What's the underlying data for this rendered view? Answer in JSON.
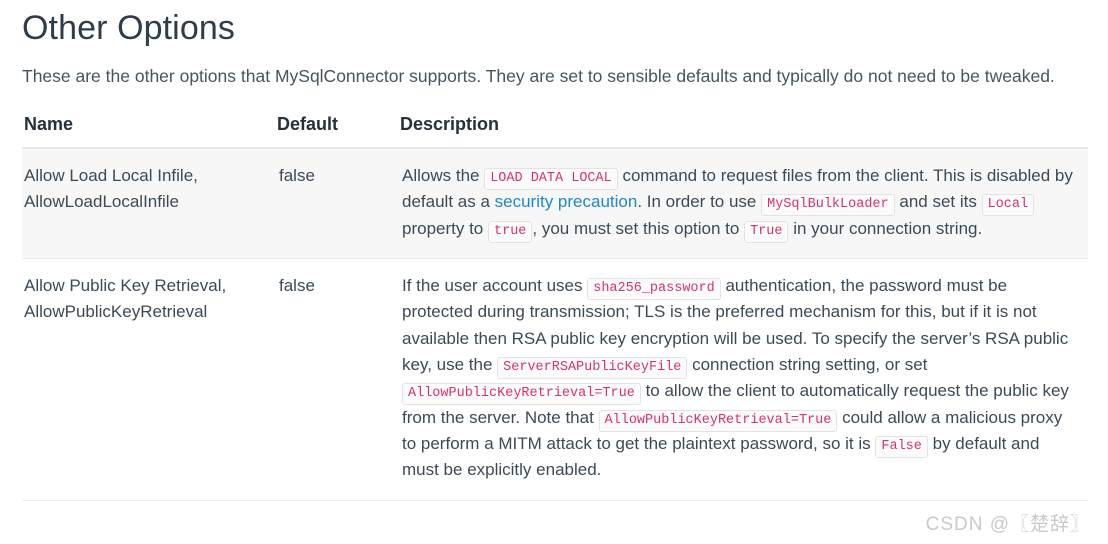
{
  "page": {
    "title": "Other Options",
    "intro": "These are the other options that MySqlConnector supports. They are set to sensible defaults and typically do not need to be tweaked.",
    "watermark": "CSDN @〖楚辞〗"
  },
  "table": {
    "headers": {
      "name": "Name",
      "default": "Default",
      "description": "Description"
    },
    "rows": [
      {
        "name": "Allow Load Local Infile, AllowLoadLocalInfile",
        "default": "false",
        "description_plain": "Allows the LOAD DATA LOCAL command to request files from the client. This is disabled by default as a security precaution. In order to use MySqlBulkLoader and set its Local property to true, you must set this option to True in your connection string.",
        "description_parts": [
          {
            "type": "text",
            "value": "Allows the "
          },
          {
            "type": "code",
            "value": "LOAD DATA LOCAL"
          },
          {
            "type": "text",
            "value": " command to request files from the client. This is disabled by default as a "
          },
          {
            "type": "link",
            "value": "security precaution"
          },
          {
            "type": "text",
            "value": ". In order to use "
          },
          {
            "type": "code",
            "value": "MySqlBulkLoader"
          },
          {
            "type": "text",
            "value": " and set its "
          },
          {
            "type": "code",
            "value": "Local"
          },
          {
            "type": "text",
            "value": " property to "
          },
          {
            "type": "code",
            "value": "true"
          },
          {
            "type": "text",
            "value": ", you must set this option to "
          },
          {
            "type": "code",
            "value": "True"
          },
          {
            "type": "text",
            "value": " in your connection string."
          }
        ]
      },
      {
        "name": "Allow Public Key Retrieval, AllowPublicKeyRetrieval",
        "default": "false",
        "description_plain": "If the user account uses sha256_password authentication, the password must be protected during transmission; TLS is the preferred mechanism for this, but if it is not available then RSA public key encryption will be used. To specify the server's RSA public key, use the ServerRSAPublicKeyFile connection string setting, or set AllowPublicKeyRetrieval=True to allow the client to automatically request the public key from the server. Note that AllowPublicKeyRetrieval=True could allow a malicious proxy to perform a MITM attack to get the plaintext password, so it is False by default and must be explicitly enabled.",
        "description_parts": [
          {
            "type": "text",
            "value": "If the user account uses "
          },
          {
            "type": "code",
            "value": "sha256_password"
          },
          {
            "type": "text",
            "value": " authentication, the password must be protected during transmission; TLS is the preferred mechanism for this, but if it is not available then RSA public key encryption will be used. To specify the server’s RSA public key, use the "
          },
          {
            "type": "code",
            "value": "ServerRSAPublicKeyFile"
          },
          {
            "type": "text",
            "value": " connection string setting, or set "
          },
          {
            "type": "code",
            "value": "AllowPublicKeyRetrieval=True"
          },
          {
            "type": "text",
            "value": " to allow the client to automatically request the public key from the server. Note that "
          },
          {
            "type": "code",
            "value": "AllowPublicKeyRetrieval=True"
          },
          {
            "type": "text",
            "value": " could allow a malicious proxy to perform a MITM attack to get the plaintext password, so it is "
          },
          {
            "type": "code",
            "value": "False"
          },
          {
            "type": "text",
            "value": " by default and must be explicitly enabled."
          }
        ]
      }
    ]
  },
  "colors": {
    "code_text": "#d6336c",
    "link": "#1e87cd",
    "body_text": "#3c4a57",
    "row_stripe": "#f7f7f7",
    "watermark": "#c9c9c9"
  }
}
